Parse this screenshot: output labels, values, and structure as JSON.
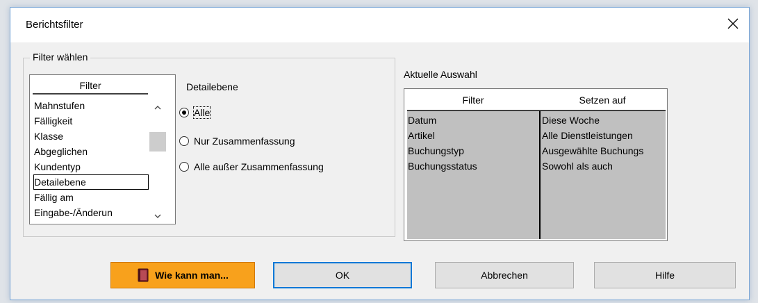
{
  "window": {
    "title": "Berichtsfilter"
  },
  "filter_group": {
    "label": "Filter wählen",
    "list_header": "Filter",
    "items": [
      {
        "label": "Mahnstufen",
        "selected": false
      },
      {
        "label": "Fälligkeit",
        "selected": false
      },
      {
        "label": "Klasse",
        "selected": false
      },
      {
        "label": "Abgeglichen",
        "selected": false
      },
      {
        "label": "Kundentyp",
        "selected": false
      },
      {
        "label": "Detailebene",
        "selected": true
      },
      {
        "label": "Fällig am",
        "selected": false
      },
      {
        "label": "Eingabe-/Änderun",
        "selected": false
      }
    ]
  },
  "detail": {
    "label": "Detailebene",
    "options": [
      {
        "label": "Alle",
        "checked": true
      },
      {
        "label": "Nur Zusammenfassung",
        "checked": false
      },
      {
        "label": "Alle außer Zusammenfassung",
        "checked": false
      }
    ]
  },
  "current": {
    "label": "Aktuelle Auswahl",
    "col_filter": "Filter",
    "col_set": "Setzen auf",
    "rows": [
      {
        "filter": "Datum",
        "value": "Diese Woche"
      },
      {
        "filter": "Artikel",
        "value": "Alle Dienstleistungen"
      },
      {
        "filter": "Buchungstyp",
        "value": "Ausgewählte Buchungs"
      },
      {
        "filter": "Buchungsstatus",
        "value": "Sowohl als auch"
      }
    ]
  },
  "buttons": {
    "how_to": "Wie kann man...",
    "ok": "OK",
    "cancel": "Abbrechen",
    "help": "Hilfe"
  },
  "colors": {
    "accent": "#0078d7",
    "help_button": "#f8a11c",
    "selection_panel": "#c0c0c0"
  }
}
